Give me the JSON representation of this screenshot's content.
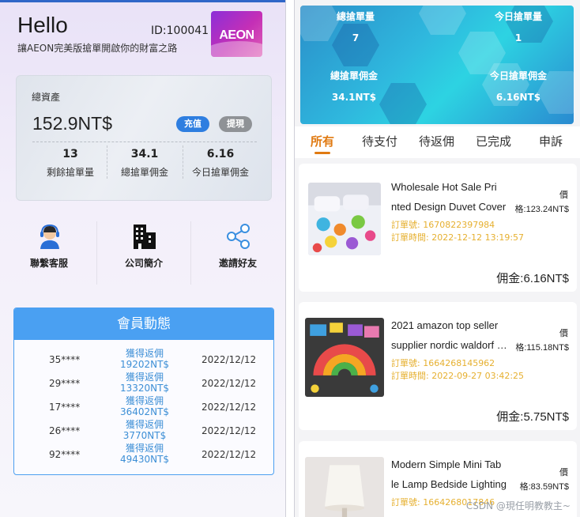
{
  "left": {
    "greeting": "Hello",
    "user_id": "ID:100041",
    "slogan": "讓AEON完美版搶單開啟你的財富之路",
    "logo_text": "AEON",
    "assets": {
      "label": "總資產",
      "value": "152.9NT$",
      "recharge_label": "充值",
      "withdraw_label": "提現",
      "stats": [
        {
          "value": "13",
          "label": "剩餘搶單量"
        },
        {
          "value": "34.1",
          "label": "總搶單佣金"
        },
        {
          "value": "6.16",
          "label": "今日搶單佣金"
        }
      ]
    },
    "shortcuts": [
      {
        "label": "聯繫客服",
        "icon": "customer-service-icon"
      },
      {
        "label": "公司簡介",
        "icon": "building-icon"
      },
      {
        "label": "邀請好友",
        "icon": "share-icon"
      }
    ],
    "members": {
      "title": "會員動態",
      "rows": [
        {
          "id": "35****",
          "action": "獲得返佣",
          "amount": "19202NT$",
          "date": "2022/12/12"
        },
        {
          "id": "29****",
          "action": "獲得返佣",
          "amount": "13320NT$",
          "date": "2022/12/12"
        },
        {
          "id": "17****",
          "action": "獲得返佣",
          "amount": "36402NT$",
          "date": "2022/12/12"
        },
        {
          "id": "26****",
          "action": "獲得返佣",
          "amount": "3770NT$",
          "date": "2022/12/12"
        },
        {
          "id": "92****",
          "action": "獲得返佣",
          "amount": "49430NT$",
          "date": "2022/12/12"
        }
      ]
    }
  },
  "right": {
    "banner": {
      "total_orders_label": "總搶單量",
      "total_orders_value": "7",
      "today_orders_label": "今日搶單量",
      "today_orders_value": "1",
      "total_comm_label": "總搶單佣金",
      "total_comm_value": "34.1NT$",
      "today_comm_label": "今日搶單佣金",
      "today_comm_value": "6.16NT$"
    },
    "tabs": [
      "所有",
      "待支付",
      "待返佣",
      "已完成",
      "申訴"
    ],
    "active_tab": "所有",
    "orders": [
      {
        "title_line1": "Wholesale Hot Sale Pri",
        "title_line2": "nted Design Duvet Cover",
        "price_label": "價",
        "price": "格:123.24NT$",
        "order_no": "訂單號: 1670822397984",
        "order_time": "訂單時間: 2022-12-12 13:19:57",
        "commission": "佣金:6.16NT$"
      },
      {
        "title_line1": "2021 amazon top seller",
        "title_line2": "supplier nordic waldorf toys",
        "price_label": "價",
        "price": "格:115.18NT$",
        "order_no": "訂單號: 1664268145962",
        "order_time": "訂單時間: 2022-09-27 03:42:25",
        "commission": "佣金:5.75NT$"
      },
      {
        "title_line1": "Modern Simple Mini Tab",
        "title_line2": "le Lamp Bedside Lighting",
        "price_label": "價",
        "price": "格:83.59NT$",
        "order_no": "訂單號: 1664268017846",
        "order_time": "",
        "commission": ""
      }
    ],
    "watermark": "CSDN @現任明教教主~"
  },
  "colors": {
    "accent_blue": "#4aa0f2",
    "tab_active": "#e07a12",
    "order_meta": "#e6b030"
  }
}
